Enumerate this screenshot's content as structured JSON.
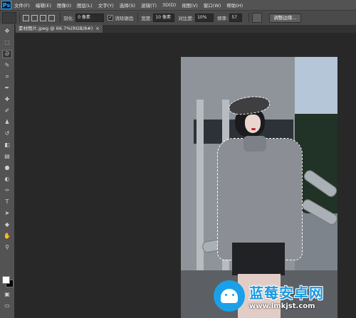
{
  "app": {
    "logo": "Ps"
  },
  "menu": [
    "文件(F)",
    "编辑(E)",
    "图像(I)",
    "图层(L)",
    "文字(Y)",
    "选择(S)",
    "滤镜(T)",
    "3D(D)",
    "视图(V)",
    "窗口(W)",
    "帮助(H)"
  ],
  "options": {
    "feather_label": "羽化:",
    "feather_value": "0 像素",
    "antialias_label": "消除锯齿",
    "width_label": "宽度:",
    "width_value": "10 像素",
    "contrast_label": "对比度:",
    "contrast_value": "10%",
    "frequency_label": "频率:",
    "frequency_value": "57",
    "refine_edge_label": "调整边缘..."
  },
  "document_tab": {
    "title": "素材图片.jpeg @ 66.7%(RGB/8#)",
    "close": "×"
  },
  "tools": [
    "move-tool",
    "marquee-tool",
    "magnetic-lasso-tool",
    "quick-selection-tool",
    "crop-tool",
    "eyedropper-tool",
    "healing-brush-tool",
    "brush-tool",
    "clone-stamp-tool",
    "history-brush-tool",
    "eraser-tool",
    "gradient-tool",
    "blur-tool",
    "dodge-tool",
    "pen-tool",
    "type-tool",
    "path-selection-tool",
    "shape-tool",
    "hand-tool",
    "zoom-tool"
  ],
  "colors": {
    "foreground": "#ffffff",
    "background": "#000000",
    "accent": "#31a8ff"
  },
  "watermark": {
    "title": "蓝莓安卓网",
    "url": "www.lmkjst.com"
  }
}
